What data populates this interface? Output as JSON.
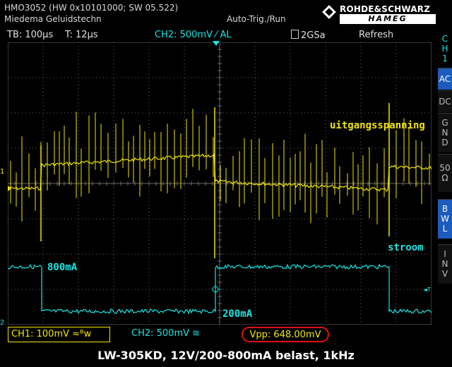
{
  "header": {
    "model_line": "HMO3052 (HW 0x10101000; SW 05.522)",
    "user_line": "Miedema Geluidstechn",
    "trigger_mode": "Auto-Trig./Run",
    "brand_name": "ROHDE&SCHWARZ",
    "brand_sub": "HAMEG"
  },
  "status_bar": {
    "timebase": "TB: 100µs",
    "trigger_time": "T: 12µs",
    "ch2_setting": "CH2: 500mV ⁄ AL",
    "sample_rate": "2GSa",
    "acquire_mode": "Refresh"
  },
  "side_menu": {
    "channel": [
      "C",
      "H",
      "1"
    ],
    "ac": "AC",
    "dc": "DC",
    "gnd": [
      "G",
      "N",
      "D"
    ],
    "ohm": [
      "50",
      "Ω"
    ],
    "bwl": [
      "B",
      "W",
      "L"
    ],
    "inv": [
      "I",
      "N",
      "V"
    ]
  },
  "traces": {
    "voltage_label": "uitgangsspanning",
    "current_label": "stroom",
    "high_level": "800mA",
    "low_level": "200mA",
    "ch1_marker": "1",
    "ch2_marker": "2",
    "voltage_color": "#f2e600",
    "current_color": "#16e6e6"
  },
  "bottom_bar": {
    "ch1": "CH1: 100mV ≈ᴮw",
    "ch2": "CH2: 500mV ≅",
    "measurement": "Vpp: 648.00mV"
  },
  "caption": "LW-305KD, 12V/200-800mA belast, 1kHz"
}
